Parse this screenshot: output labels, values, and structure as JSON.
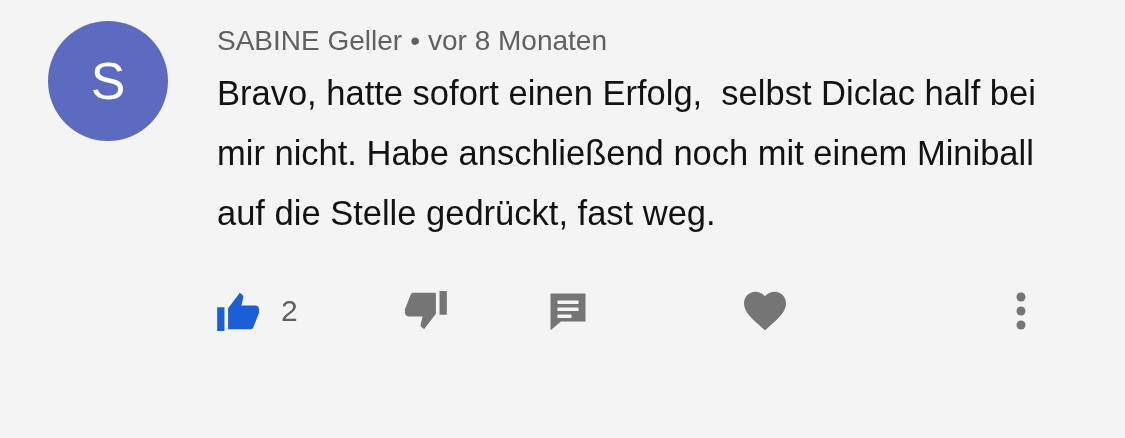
{
  "comment": {
    "avatar_letter": "S",
    "author": "SABINE Geller",
    "separator": "•",
    "time": "vor 8 Monaten",
    "text": "Bravo, hatte sofort einen Erfolg,  selbst Diclac half bei mir nicht. Habe anschließend noch mit einem Miniball auf die Stelle gedrückt, fast weg.",
    "liked": true,
    "like_count": "2",
    "hearted": false
  }
}
